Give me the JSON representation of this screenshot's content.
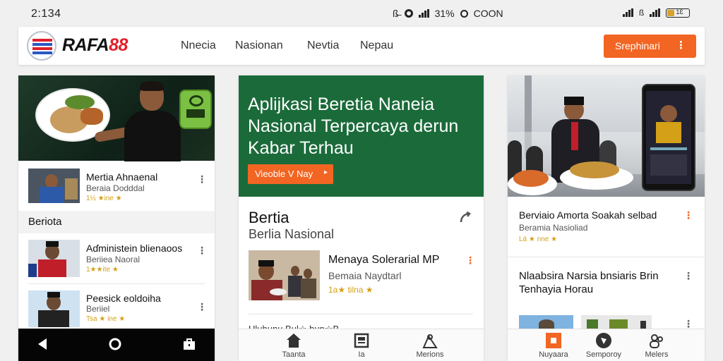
{
  "status": {
    "time": "2:134",
    "mid_a": "ß̶",
    "mid_b": "31%",
    "mid_c": "COON",
    "battery": "1Ɛ"
  },
  "header": {
    "logo_main": "RAFA",
    "logo_num": "88",
    "nav": [
      "Nnecia",
      "Nasionan",
      "Nevtia",
      "Nepau"
    ],
    "cta_label": "Srephinari",
    "brand_color": "#f26522"
  },
  "left": {
    "items": [
      {
        "title": "Mertia Ahnaenal",
        "source": "Beraia Dodddal",
        "rating": "1½ ★ine ★"
      },
      {
        "title": "Aɗministein blienaoos",
        "source": "Beriiea Naoral",
        "rating": "1★★ite ★"
      },
      {
        "title": "Peesick eoldoiha",
        "source": "Beriiel",
        "rating": "Tsa ★ ine ★"
      }
    ],
    "section": "Beriota"
  },
  "center": {
    "hero_lines": [
      "Aplijkasi Beretia Naneia",
      "Nasional Terpercaya derun",
      "Kabar Terhau"
    ],
    "hero_button": "Vieoble V Nay",
    "hero_button_icon": "▸",
    "section_title": "Bertia",
    "section_sub": "Berlia Nasional",
    "article": {
      "title": "Menaya Solerarial MP",
      "source": "Bemaia Naydtarl",
      "rating": "1a★ tilna ★"
    },
    "truncated": "Ulubunu Bul☆ bun☆B",
    "tabs": [
      "Taanta",
      "Ia",
      "Merions"
    ]
  },
  "right": {
    "items": [
      {
        "title": "Berviaio Amorta Soakah selbad",
        "source": "Beramia Nasioliad",
        "rating": "Lä ★ nne ★"
      },
      {
        "title": "Nlaabsira Narsia bnsiaris Brin",
        "title2": "Tenhayia Horau"
      }
    ],
    "tabs": [
      "Nuyaara",
      "Semporoy",
      "Melers"
    ]
  }
}
